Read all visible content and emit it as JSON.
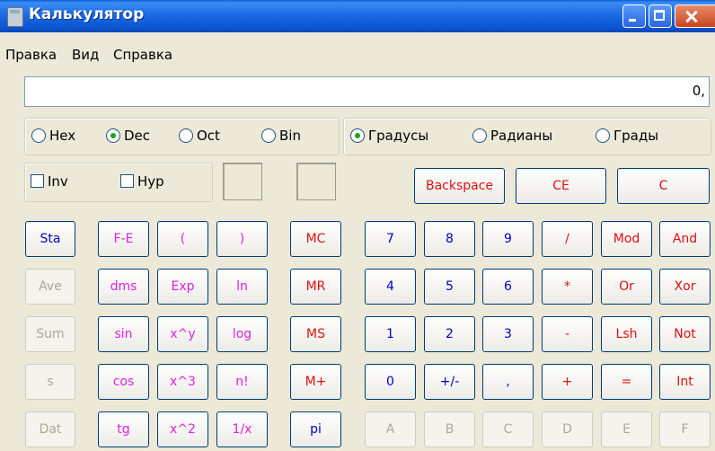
{
  "window": {
    "title": "Калькулятор"
  },
  "menu": [
    "Правка",
    "Вид",
    "Справка"
  ],
  "display": {
    "value": "0,"
  },
  "radix": {
    "options": [
      "Hex",
      "Dec",
      "Oct",
      "Bin"
    ],
    "selected": "Dec"
  },
  "angle": {
    "options": [
      "Градусы",
      "Радианы",
      "Грады"
    ],
    "selected": "Градусы"
  },
  "checks": {
    "inv": "Inv",
    "hyp": "Hyp"
  },
  "top_buttons": {
    "backspace": "Backspace",
    "ce": "CE",
    "c": "C"
  },
  "stat_buttons": [
    "Sta",
    "Ave",
    "Sum",
    "s",
    "Dat"
  ],
  "sci": [
    [
      "F-E",
      "(",
      ")"
    ],
    [
      "dms",
      "Exp",
      "ln"
    ],
    [
      "sin",
      "x^y",
      "log"
    ],
    [
      "cos",
      "x^3",
      "n!"
    ],
    [
      "tg",
      "x^2",
      "1/x"
    ]
  ],
  "memory": [
    "MC",
    "MR",
    "MS",
    "M+",
    "pi"
  ],
  "keypad": [
    [
      "7",
      "8",
      "9",
      "/",
      "Mod",
      "And"
    ],
    [
      "4",
      "5",
      "6",
      "*",
      "Or",
      "Xor"
    ],
    [
      "1",
      "2",
      "3",
      "-",
      "Lsh",
      "Not"
    ],
    [
      "0",
      "+/-",
      ",",
      "+",
      "=",
      "Int"
    ],
    [
      "A",
      "B",
      "C",
      "D",
      "E",
      "F"
    ]
  ],
  "colors": {
    "blue_text": "#0000c8",
    "red_text": "#e01010",
    "magenta_text": "#e020e0",
    "disabled_text": "#aca899",
    "titlebar": "#1f6fe6",
    "radio_dot": "#21a121"
  }
}
